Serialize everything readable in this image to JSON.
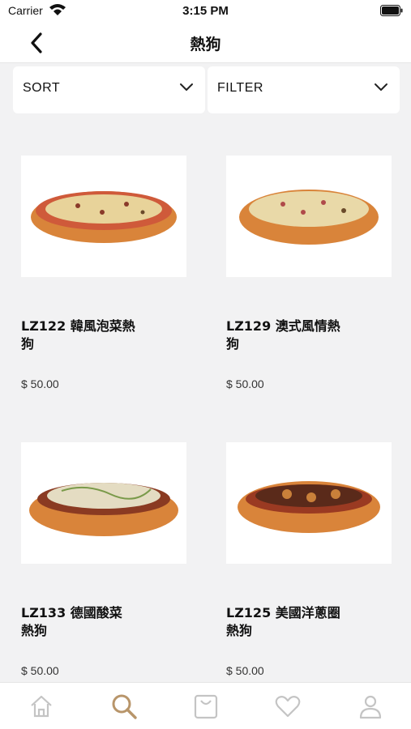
{
  "status_bar": {
    "carrier": "Carrier",
    "time": "3:15 PM"
  },
  "nav": {
    "title": "熱狗"
  },
  "controls": {
    "sort_label": "SORT",
    "filter_label": "FILTER"
  },
  "products": [
    {
      "name_line1": "LZ122 韓風泡菜熱",
      "name_line2": "狗",
      "price": "$ 50.00"
    },
    {
      "name_line1": "LZ129 澳式風情熱",
      "name_line2": "狗",
      "price": "$ 50.00"
    },
    {
      "name_line1": "LZ133 德國酸菜",
      "name_line2": "熱狗",
      "price": "$ 50.00"
    },
    {
      "name_line1": "LZ125 美國洋蔥圈",
      "name_line2": "熱狗",
      "price": "$ 50.00"
    }
  ],
  "tabs": [
    {
      "icon": "home-icon",
      "active": false
    },
    {
      "icon": "search-icon",
      "active": true
    },
    {
      "icon": "shopping-bag-icon",
      "active": false
    },
    {
      "icon": "heart-icon",
      "active": false
    },
    {
      "icon": "profile-icon",
      "active": false
    }
  ],
  "colors": {
    "accent": "#b8956a",
    "inactive": "#c4c4c4",
    "background": "#f2f2f3"
  }
}
